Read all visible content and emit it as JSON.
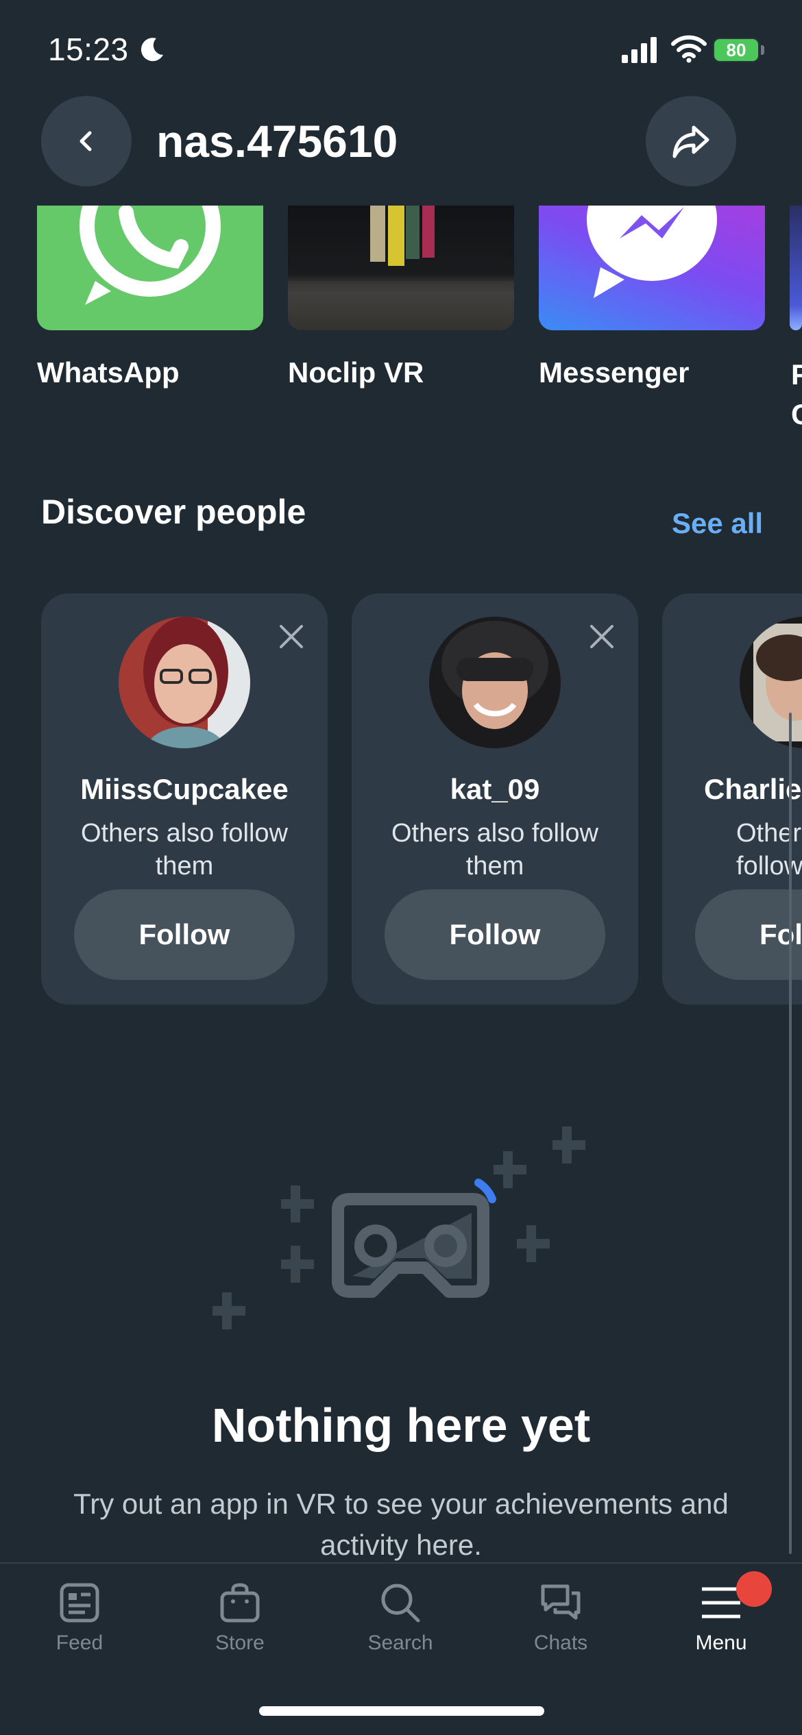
{
  "status_bar": {
    "time": "15:23",
    "battery": "80"
  },
  "header": {
    "title": "nas.475610"
  },
  "apps": [
    {
      "label": "WhatsApp"
    },
    {
      "label": "Noclip VR"
    },
    {
      "label": "Messenger"
    },
    {
      "label": "F\nC"
    }
  ],
  "discover": {
    "title": "Discover people",
    "see_all": "See all",
    "people": [
      {
        "name": "MiissCupcakee",
        "subtitle": "Others also follow them",
        "follow": "Follow"
      },
      {
        "name": "kat_09",
        "subtitle": "Others also follow them",
        "follow": "Follow"
      },
      {
        "name": "Charlie",
        "subtitle": "Others also follow them",
        "follow": "Follow"
      }
    ]
  },
  "empty_state": {
    "title": "Nothing here yet",
    "description": "Try out an app in VR to see your achievements and activity here."
  },
  "tabbar": [
    {
      "label": "Feed",
      "icon": "feed-icon"
    },
    {
      "label": "Store",
      "icon": "store-icon"
    },
    {
      "label": "Search",
      "icon": "search-icon"
    },
    {
      "label": "Chats",
      "icon": "chats-icon"
    },
    {
      "label": "Menu",
      "icon": "menu-icon",
      "active": true
    }
  ],
  "colors": {
    "background": "#1f2a33",
    "card": "#2e3a45",
    "accent": "#6aaef5",
    "badge": "#e8453c"
  }
}
